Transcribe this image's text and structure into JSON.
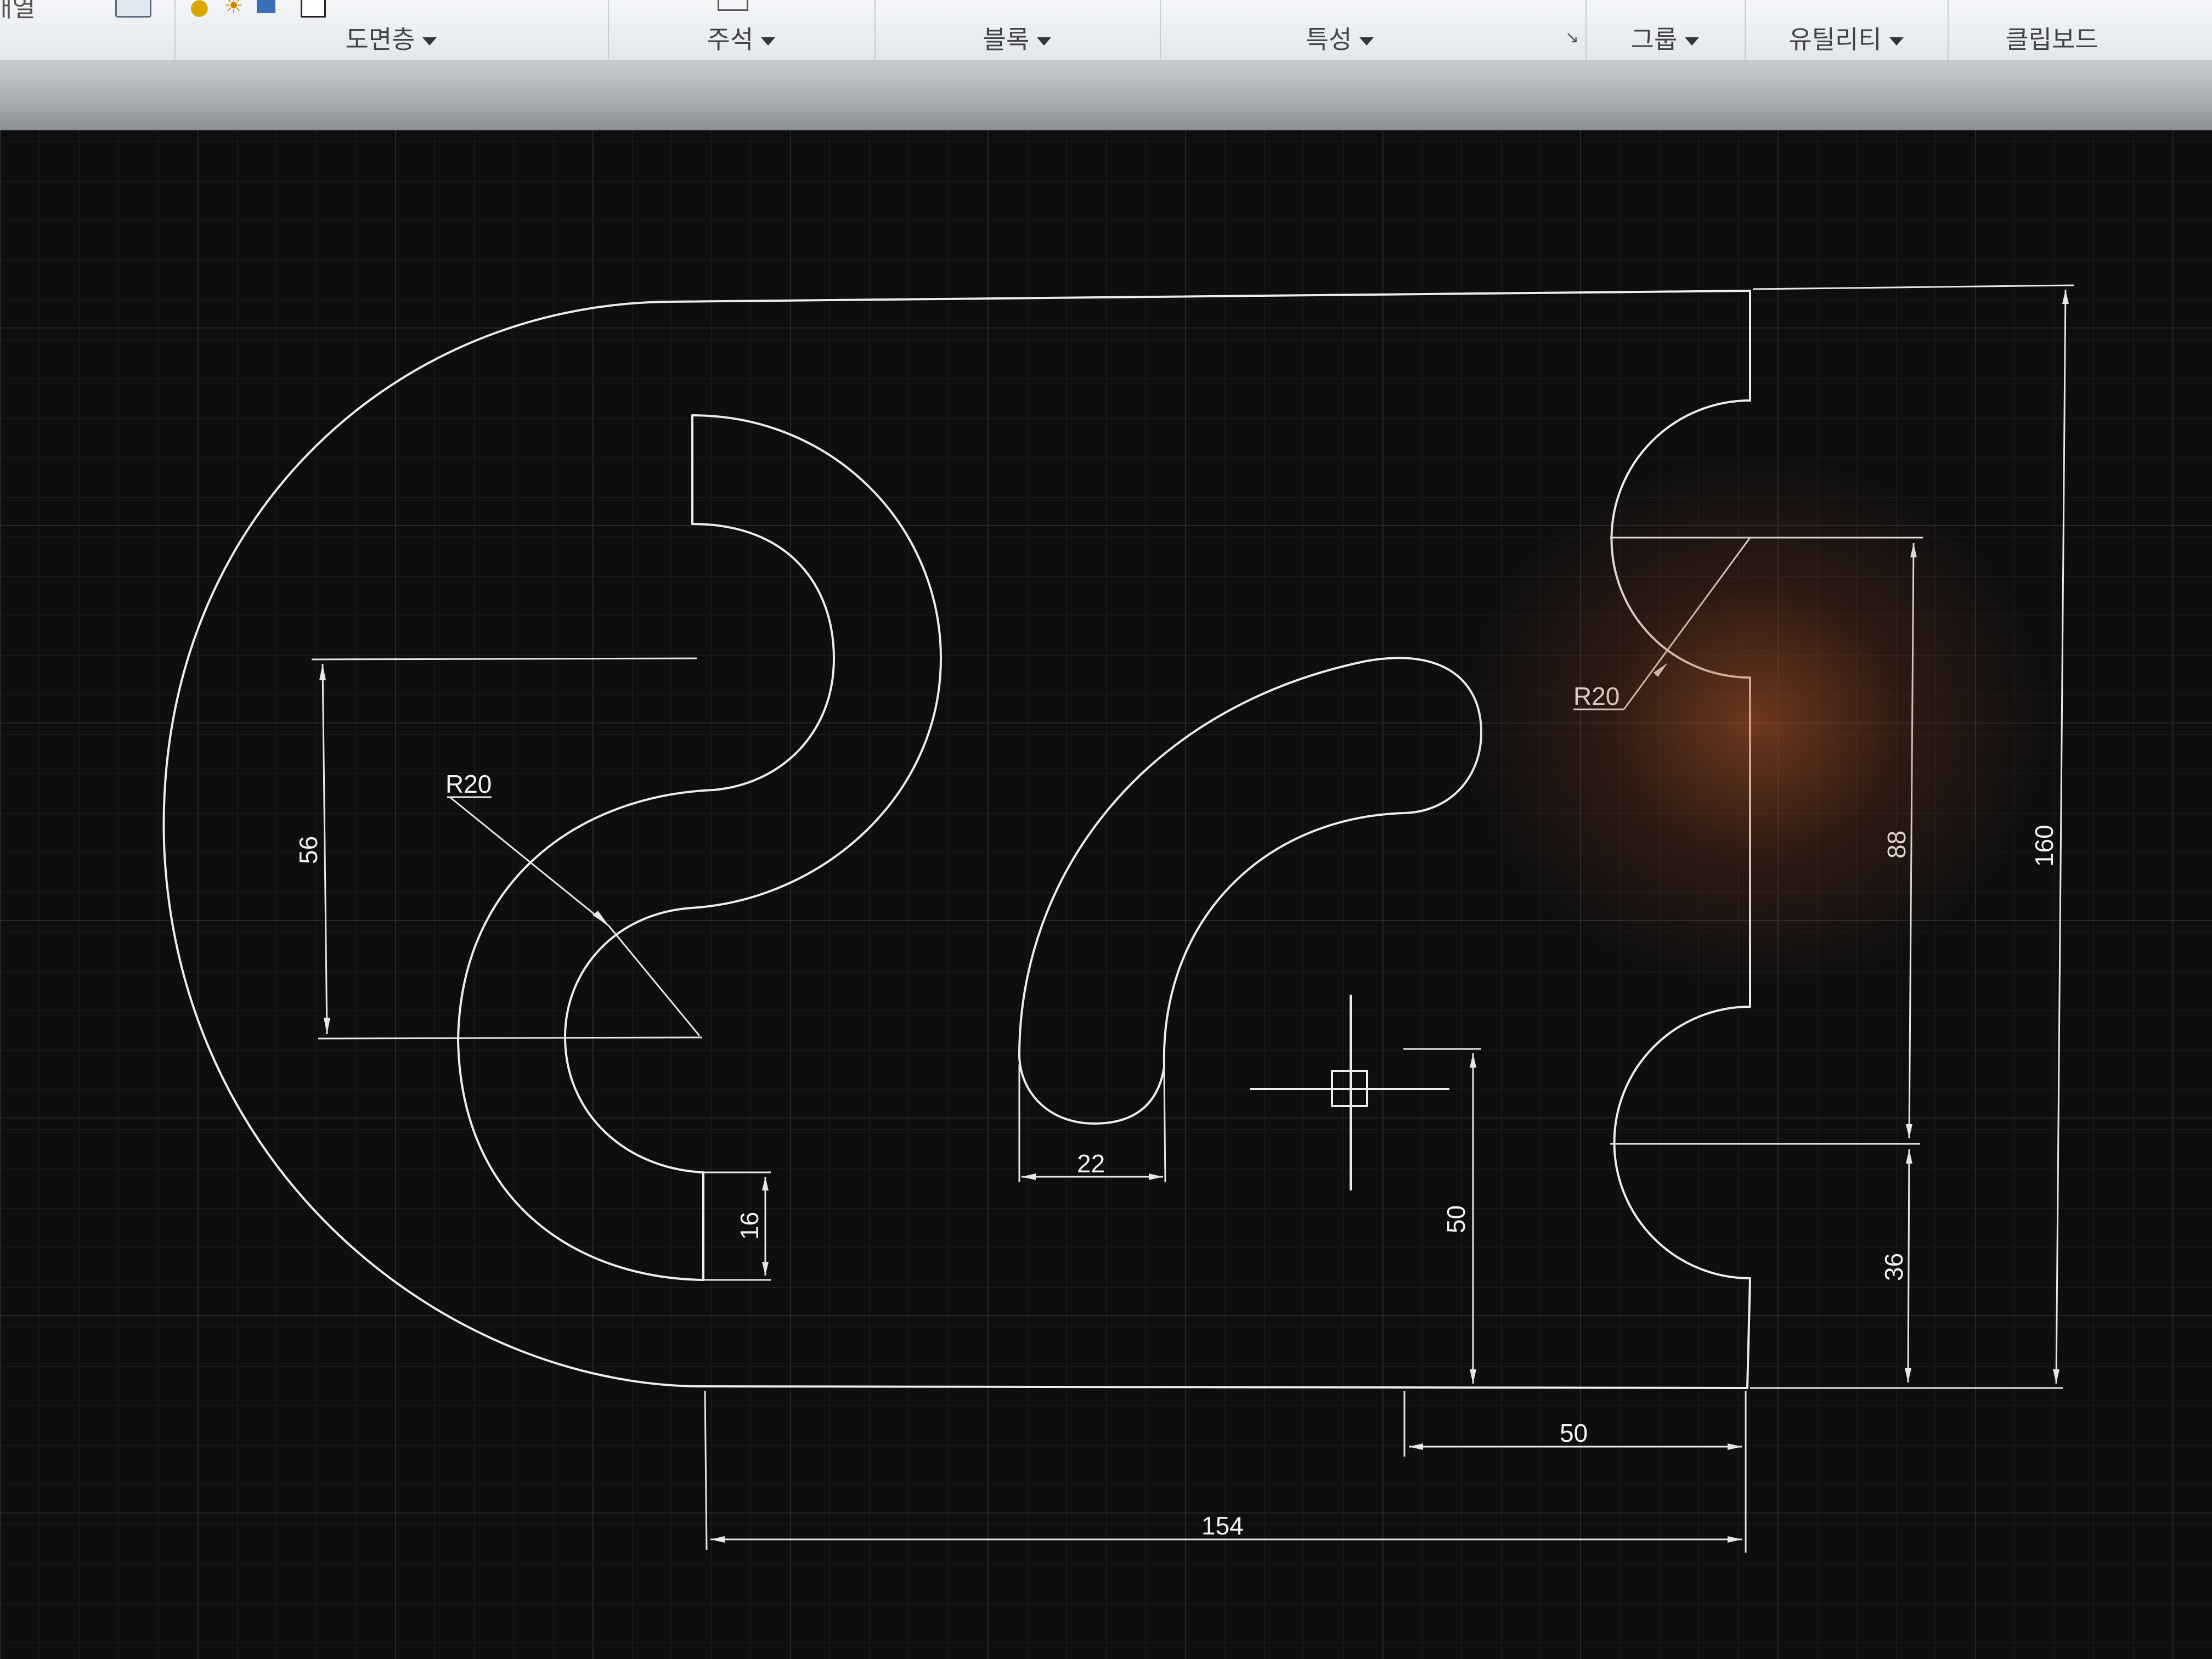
{
  "ribbon": {
    "fragment_label": "배열",
    "panels": [
      {
        "label": "도면층"
      },
      {
        "label": "주석"
      },
      {
        "label": "블록"
      },
      {
        "label": "특성"
      },
      {
        "label": "그룹"
      },
      {
        "label": "유틸리티"
      },
      {
        "label": "클립보드"
      }
    ]
  },
  "drawing": {
    "dimensions": {
      "r20_left": "R20",
      "r20_right": "R20",
      "d56": "56",
      "d16": "16",
      "d22": "22",
      "d50_vertical": "50",
      "d50_horizontal": "50",
      "d154": "154",
      "d88": "88",
      "d36": "36",
      "d160": "160"
    }
  }
}
